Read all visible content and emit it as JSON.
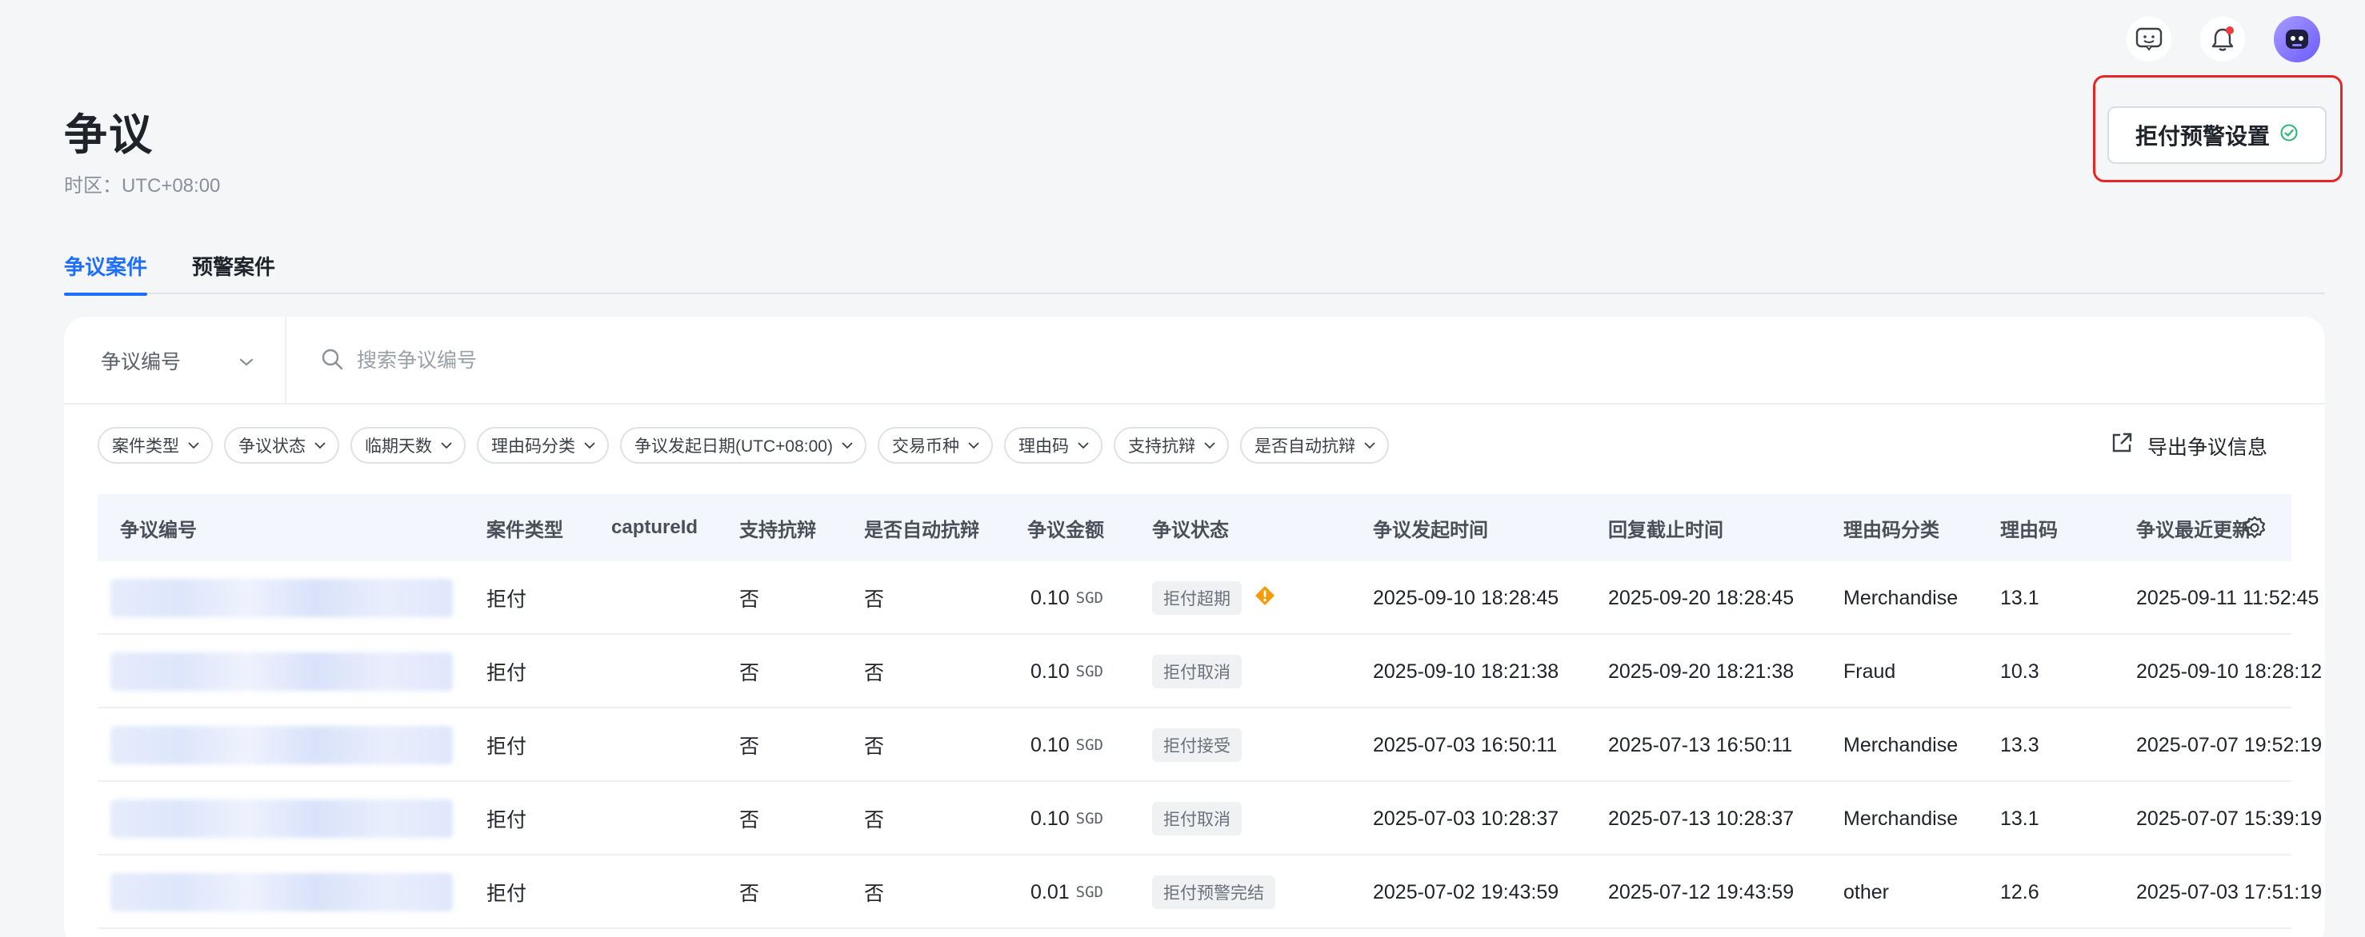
{
  "page": {
    "title": "争议",
    "timezone": "时区：UTC+08:00",
    "alert_settings_label": "拒付预警设置"
  },
  "tabs": [
    {
      "label": "争议案件",
      "active": true
    },
    {
      "label": "预警案件",
      "active": false
    }
  ],
  "search": {
    "field_select": "争议编号",
    "placeholder": "搜索争议编号"
  },
  "filters": [
    "案件类型",
    "争议状态",
    "临期天数",
    "理由码分类",
    "争议发起日期(UTC+08:00)",
    "交易币种",
    "理由码",
    "支持抗辩",
    "是否自动抗辩"
  ],
  "export_label": "导出争议信息",
  "table": {
    "headers": {
      "dispute_id": "争议编号",
      "case_type": "案件类型",
      "capture_id": "captureId",
      "defensible": "支持抗辩",
      "auto_defense": "是否自动抗辩",
      "amount": "争议金额",
      "status": "争议状态",
      "created_at": "争议发起时间",
      "reply_deadline": "回复截止时间",
      "reason_category": "理由码分类",
      "reason_code": "理由码",
      "last_updated": "争议最近更新"
    },
    "rows": [
      {
        "case_type": "拒付",
        "defensible": "否",
        "auto_defense": "否",
        "amount": "0.10",
        "currency": "SGD",
        "status": "拒付超期",
        "warning": true,
        "created_at": "2025-09-10 18:28:45",
        "reply_deadline": "2025-09-20 18:28:45",
        "reason_category": "Merchandise",
        "reason_code": "13.1",
        "last_updated": "2025-09-11 11:52:45"
      },
      {
        "case_type": "拒付",
        "defensible": "否",
        "auto_defense": "否",
        "amount": "0.10",
        "currency": "SGD",
        "status": "拒付取消",
        "warning": false,
        "created_at": "2025-09-10 18:21:38",
        "reply_deadline": "2025-09-20 18:21:38",
        "reason_category": "Fraud",
        "reason_code": "10.3",
        "last_updated": "2025-09-10 18:28:12"
      },
      {
        "case_type": "拒付",
        "defensible": "否",
        "auto_defense": "否",
        "amount": "0.10",
        "currency": "SGD",
        "status": "拒付接受",
        "warning": false,
        "created_at": "2025-07-03 16:50:11",
        "reply_deadline": "2025-07-13 16:50:11",
        "reason_category": "Merchandise",
        "reason_code": "13.3",
        "last_updated": "2025-07-07 19:52:19"
      },
      {
        "case_type": "拒付",
        "defensible": "否",
        "auto_defense": "否",
        "amount": "0.10",
        "currency": "SGD",
        "status": "拒付取消",
        "warning": false,
        "created_at": "2025-07-03 10:28:37",
        "reply_deadline": "2025-07-13 10:28:37",
        "reason_category": "Merchandise",
        "reason_code": "13.1",
        "last_updated": "2025-07-07 15:39:19"
      },
      {
        "case_type": "拒付",
        "defensible": "否",
        "auto_defense": "否",
        "amount": "0.01",
        "currency": "SGD",
        "status": "拒付预警完结",
        "warning": false,
        "created_at": "2025-07-02 19:43:59",
        "reply_deadline": "2025-07-12 19:43:59",
        "reason_category": "other",
        "reason_code": "12.6",
        "last_updated": "2025-07-03 17:51:19"
      }
    ]
  },
  "icons": {
    "feedback": "feedback-icon",
    "notification": "bell-icon",
    "avatar": "robot-avatar",
    "check": "check-circle-icon",
    "search": "search-icon",
    "export": "external-link-icon",
    "settings": "gear-icon",
    "warning": "warning-icon"
  },
  "colors": {
    "accent": "#1f6fff",
    "highlight_outline": "#e82626",
    "success": "#2bb673",
    "warning": "#f59a0b"
  }
}
